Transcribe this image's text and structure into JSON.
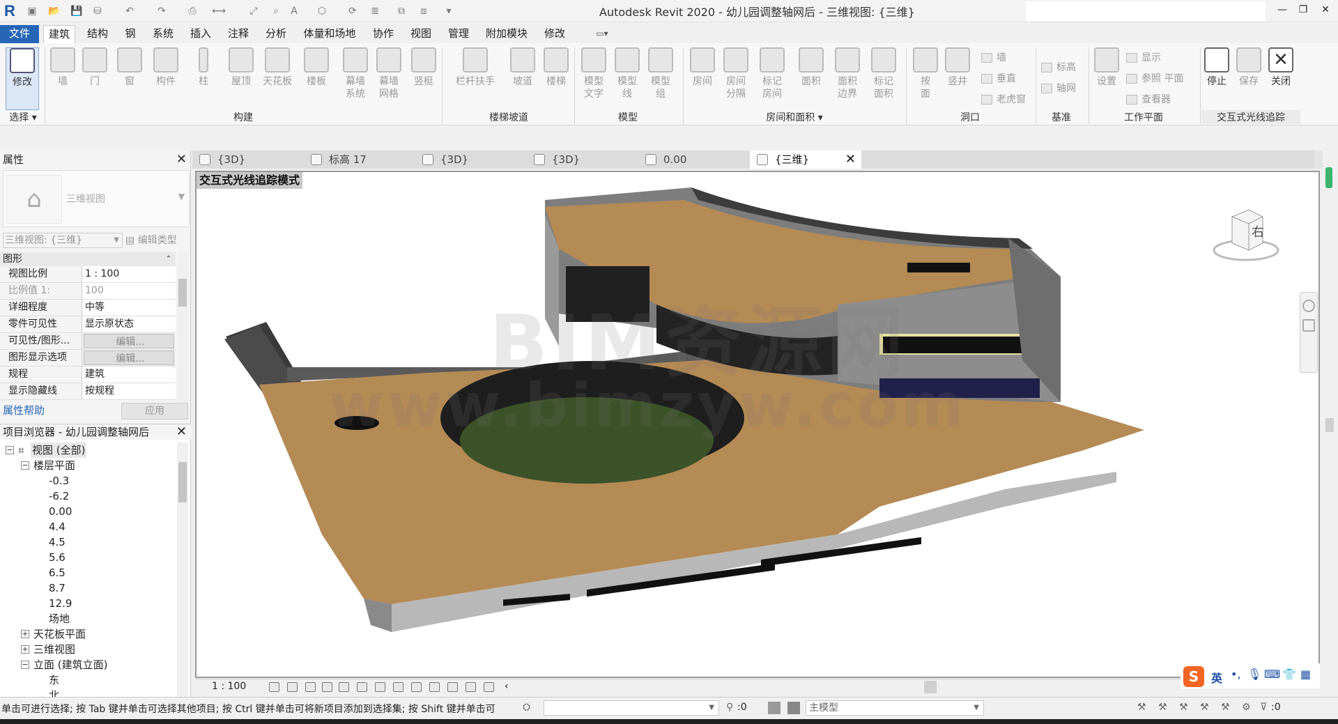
{
  "app": {
    "title": "Autodesk Revit 2020 - 幼儿园调整轴网后 - 三维视图: {三维}",
    "logo": "R"
  },
  "window_controls": {
    "minimize": "—",
    "restore": "❐",
    "close": "✕"
  },
  "menu": [
    "文件",
    "建筑",
    "结构",
    "钢",
    "系统",
    "插入",
    "注释",
    "分析",
    "体量和场地",
    "协作",
    "视图",
    "管理",
    "附加模块",
    "修改"
  ],
  "menu_active": "建筑",
  "ribbon": {
    "modify": "修改",
    "select": "选择",
    "build": {
      "label": "构建",
      "items": [
        "墙",
        "门",
        "窗",
        "构件",
        "柱",
        "屋顶",
        "天花板",
        "楼板",
        "幕墙\n系统",
        "幕墙\n网格",
        "竖梃"
      ]
    },
    "stairs": {
      "label": "楼梯坡道",
      "items": [
        "栏杆扶手",
        "坡道",
        "楼梯"
      ]
    },
    "model": {
      "label": "模型",
      "items": [
        "模型\n文字",
        "模型\n线",
        "模型\n组"
      ]
    },
    "room": {
      "label": "房间和面积",
      "items": [
        "房间",
        "房间\n分隔",
        "标记\n房间",
        "面积",
        "面积\n边界",
        "标记\n面积"
      ]
    },
    "opening": {
      "label": "洞口",
      "items": [
        "按\n面",
        "竖井"
      ],
      "small": [
        "墙",
        "垂直",
        "老虎窗"
      ]
    },
    "datum": {
      "label": "基准",
      "small": [
        "标高",
        "轴网"
      ]
    },
    "workplane": {
      "label": "工作平面",
      "items": [
        "设置"
      ],
      "small": [
        "显示",
        "参照 平面",
        "查看器"
      ]
    },
    "raytrace": {
      "label": "交互式光线追踪",
      "items": [
        "停止",
        "保存",
        "关闭"
      ]
    }
  },
  "properties": {
    "title": "属性",
    "type_name": "三维视图",
    "view_select": "三维视图: {三维}",
    "edit_type": "编辑类型",
    "group": "图形",
    "rows": [
      {
        "k": "视图比例",
        "v": "1 : 100"
      },
      {
        "k": "比例值 1:",
        "v": "100"
      },
      {
        "k": "详细程度",
        "v": "中等"
      },
      {
        "k": "零件可见性",
        "v": "显示原状态"
      },
      {
        "k": "可见性/图形...",
        "v": "编辑..."
      },
      {
        "k": "图形显示选项",
        "v": "编辑..."
      },
      {
        "k": "规程",
        "v": "建筑"
      },
      {
        "k": "显示隐藏线",
        "v": "按规程"
      }
    ],
    "help": "属性帮助",
    "apply": "应用"
  },
  "browser": {
    "title": "项目浏览器 - 幼儿园调整轴网后",
    "tree": [
      {
        "label": "视图 (全部)",
        "level": 0,
        "toggle": "−"
      },
      {
        "label": "楼层平面",
        "level": 1,
        "toggle": "−"
      },
      {
        "label": "-0.3",
        "level": 2
      },
      {
        "label": "-6.2",
        "level": 2
      },
      {
        "label": "0.00",
        "level": 2
      },
      {
        "label": "4.4",
        "level": 2
      },
      {
        "label": "4.5",
        "level": 2
      },
      {
        "label": "5.6",
        "level": 2
      },
      {
        "label": "6.5",
        "level": 2
      },
      {
        "label": "8.7",
        "level": 2
      },
      {
        "label": "12.9",
        "level": 2
      },
      {
        "label": "场地",
        "level": 2
      },
      {
        "label": "天花板平面",
        "level": 1,
        "toggle": "+"
      },
      {
        "label": "三维视图",
        "level": 1,
        "toggle": "+"
      },
      {
        "label": "立面 (建筑立面)",
        "level": 1,
        "toggle": "−"
      },
      {
        "label": "东",
        "level": 2
      },
      {
        "label": "北",
        "level": 2
      }
    ]
  },
  "view_tabs": [
    {
      "label": "{3D}"
    },
    {
      "label": "标高 17"
    },
    {
      "label": "{3D}"
    },
    {
      "label": "{3D}"
    },
    {
      "label": "0.00"
    },
    {
      "label": "{三维}",
      "active": true
    }
  ],
  "viewport": {
    "mode_label": "交互式光线追踪模式",
    "viewcube_face": "右",
    "watermark_1": "BIM资源网",
    "watermark_2": "www.bimzyw.com"
  },
  "view_control": {
    "scale": "1 : 100"
  },
  "ime": {
    "lang": "英"
  },
  "status": {
    "message": "单击可进行选择; 按 Tab 键并单击可选择其他项目; 按 Ctrl 键并单击可将新项目添加到选择集; 按 Shift 键并单击可",
    "count": ":0",
    "model": "主模型",
    "filter": ":0"
  }
}
